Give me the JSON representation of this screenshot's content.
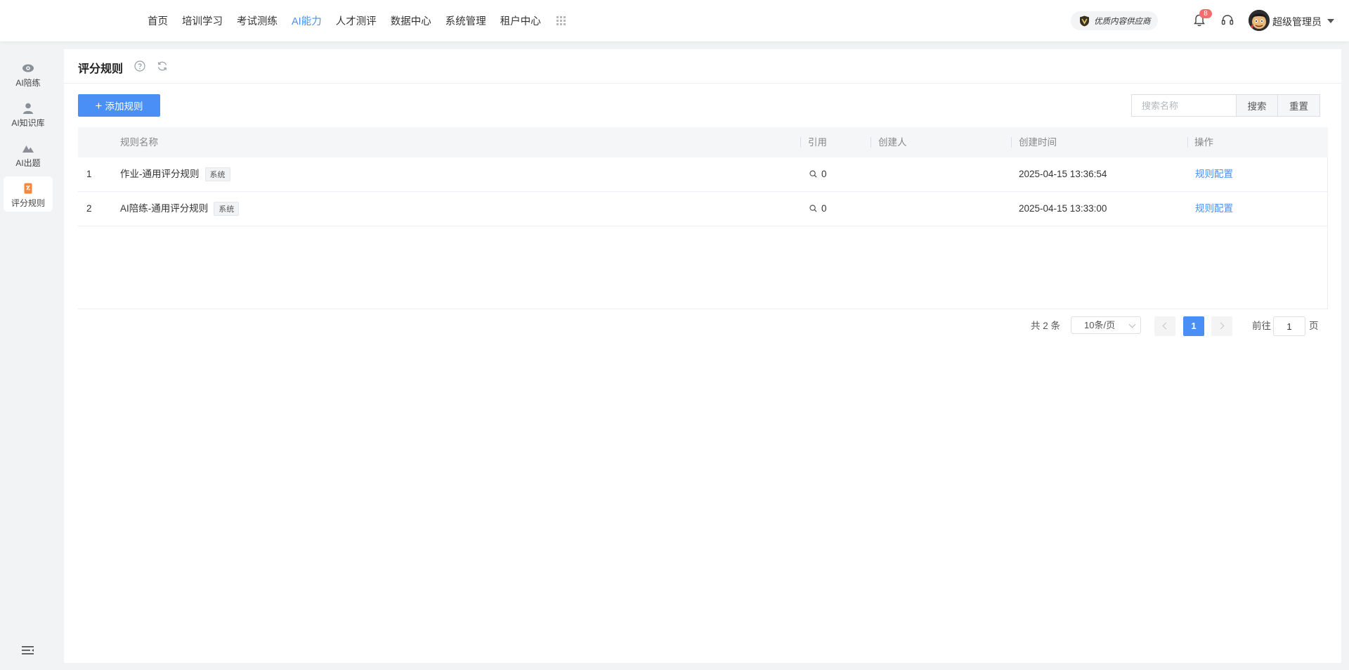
{
  "topnav": {
    "items": [
      {
        "label": "首页",
        "active": false
      },
      {
        "label": "培训学习",
        "active": false
      },
      {
        "label": "考试测练",
        "active": false
      },
      {
        "label": "AI能力",
        "active": true
      },
      {
        "label": "人才测评",
        "active": false
      },
      {
        "label": "数据中心",
        "active": false
      },
      {
        "label": "系统管理",
        "active": false
      },
      {
        "label": "租户中心",
        "active": false
      }
    ],
    "apps_icon": "grid-icon",
    "supplier_label": "优质内容供应商",
    "notification_count": "8",
    "user_name": "超级管理员"
  },
  "sidebar": {
    "items": [
      {
        "label": "AI陪练",
        "icon": "eye-icon",
        "active": false
      },
      {
        "label": "AI知识库",
        "icon": "person-icon",
        "active": false
      },
      {
        "label": "AI出题",
        "icon": "mountain-icon",
        "active": false
      },
      {
        "label": "评分规则",
        "icon": "rules-icon",
        "active": true
      }
    ],
    "collapse_icon": "menu-collapse-icon"
  },
  "page": {
    "title": "评分规则",
    "add_button": "添加规则",
    "search_placeholder": "搜索名称",
    "search_button": "搜索",
    "reset_button": "重置"
  },
  "table": {
    "columns": [
      "规则名称",
      "引用",
      "创建人",
      "创建时间",
      "操作"
    ],
    "rows": [
      {
        "index": "1",
        "name": "作业-通用评分规则",
        "tag": "系统",
        "refs": "0",
        "creator": "",
        "created_at": "2025-04-15 13:36:54",
        "action": "规则配置"
      },
      {
        "index": "2",
        "name": "AI陪练-通用评分规则",
        "tag": "系统",
        "refs": "0",
        "creator": "",
        "created_at": "2025-04-15 13:33:00",
        "action": "规则配置"
      }
    ]
  },
  "pagination": {
    "total_text": "共 2 条",
    "page_size": "10条/页",
    "current_page": "1",
    "goto_prefix": "前往",
    "goto_value": "1",
    "goto_suffix": "页"
  },
  "colors": {
    "accent": "#4a8ff5",
    "badge": "#f56c6c"
  }
}
